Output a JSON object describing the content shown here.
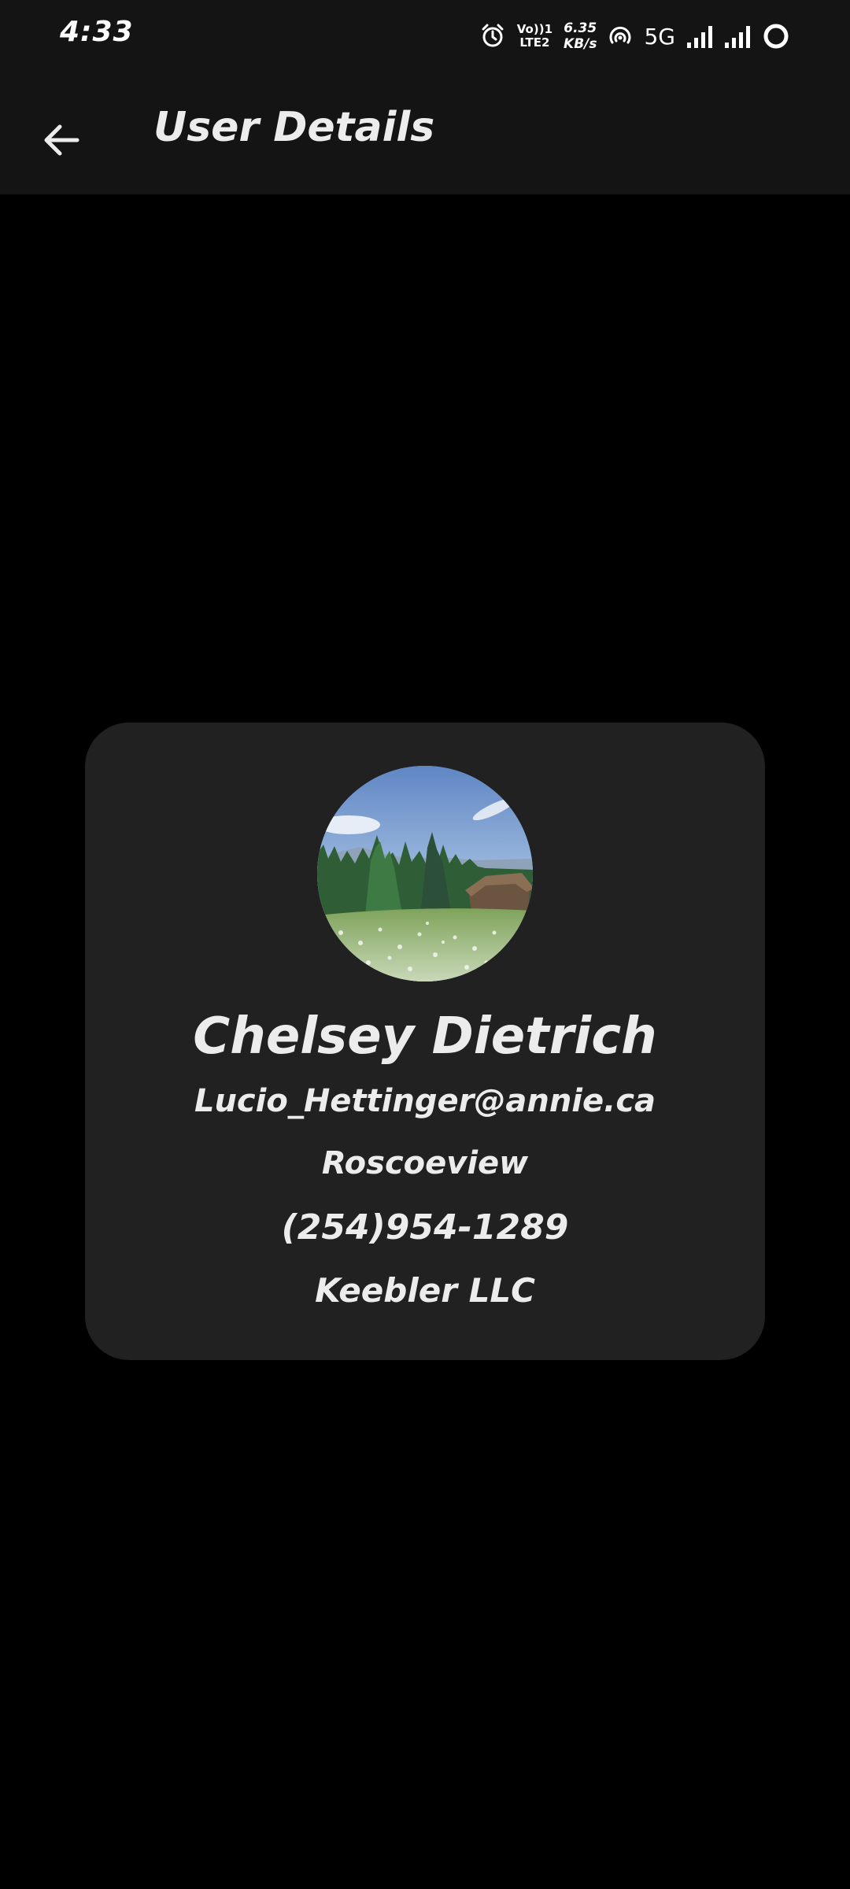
{
  "status_bar": {
    "time": "4:33",
    "volte_top": "Vo))1",
    "volte_bottom": "LTE2",
    "speed_value": "6.35",
    "speed_unit": "KB/s",
    "network_type": "5G",
    "icons": [
      "alarm-icon",
      "volte-icon",
      "hotspot-icon",
      "signal-icon",
      "signal-icon",
      "battery-icon"
    ]
  },
  "toolbar": {
    "title": "User Details",
    "back_icon": "arrow-left-icon"
  },
  "user": {
    "name": "Chelsey Dietrich",
    "email": "Lucio_Hettinger@annie.ca",
    "city": "Roscoeview",
    "phone": "(254)954-1289",
    "company": "Keebler LLC",
    "avatar": "landscape photo: meadow, pine trees, cabin"
  },
  "colors": {
    "background": "#000000",
    "toolbar": "#141414",
    "card": "#212121",
    "text": "#ececec"
  }
}
